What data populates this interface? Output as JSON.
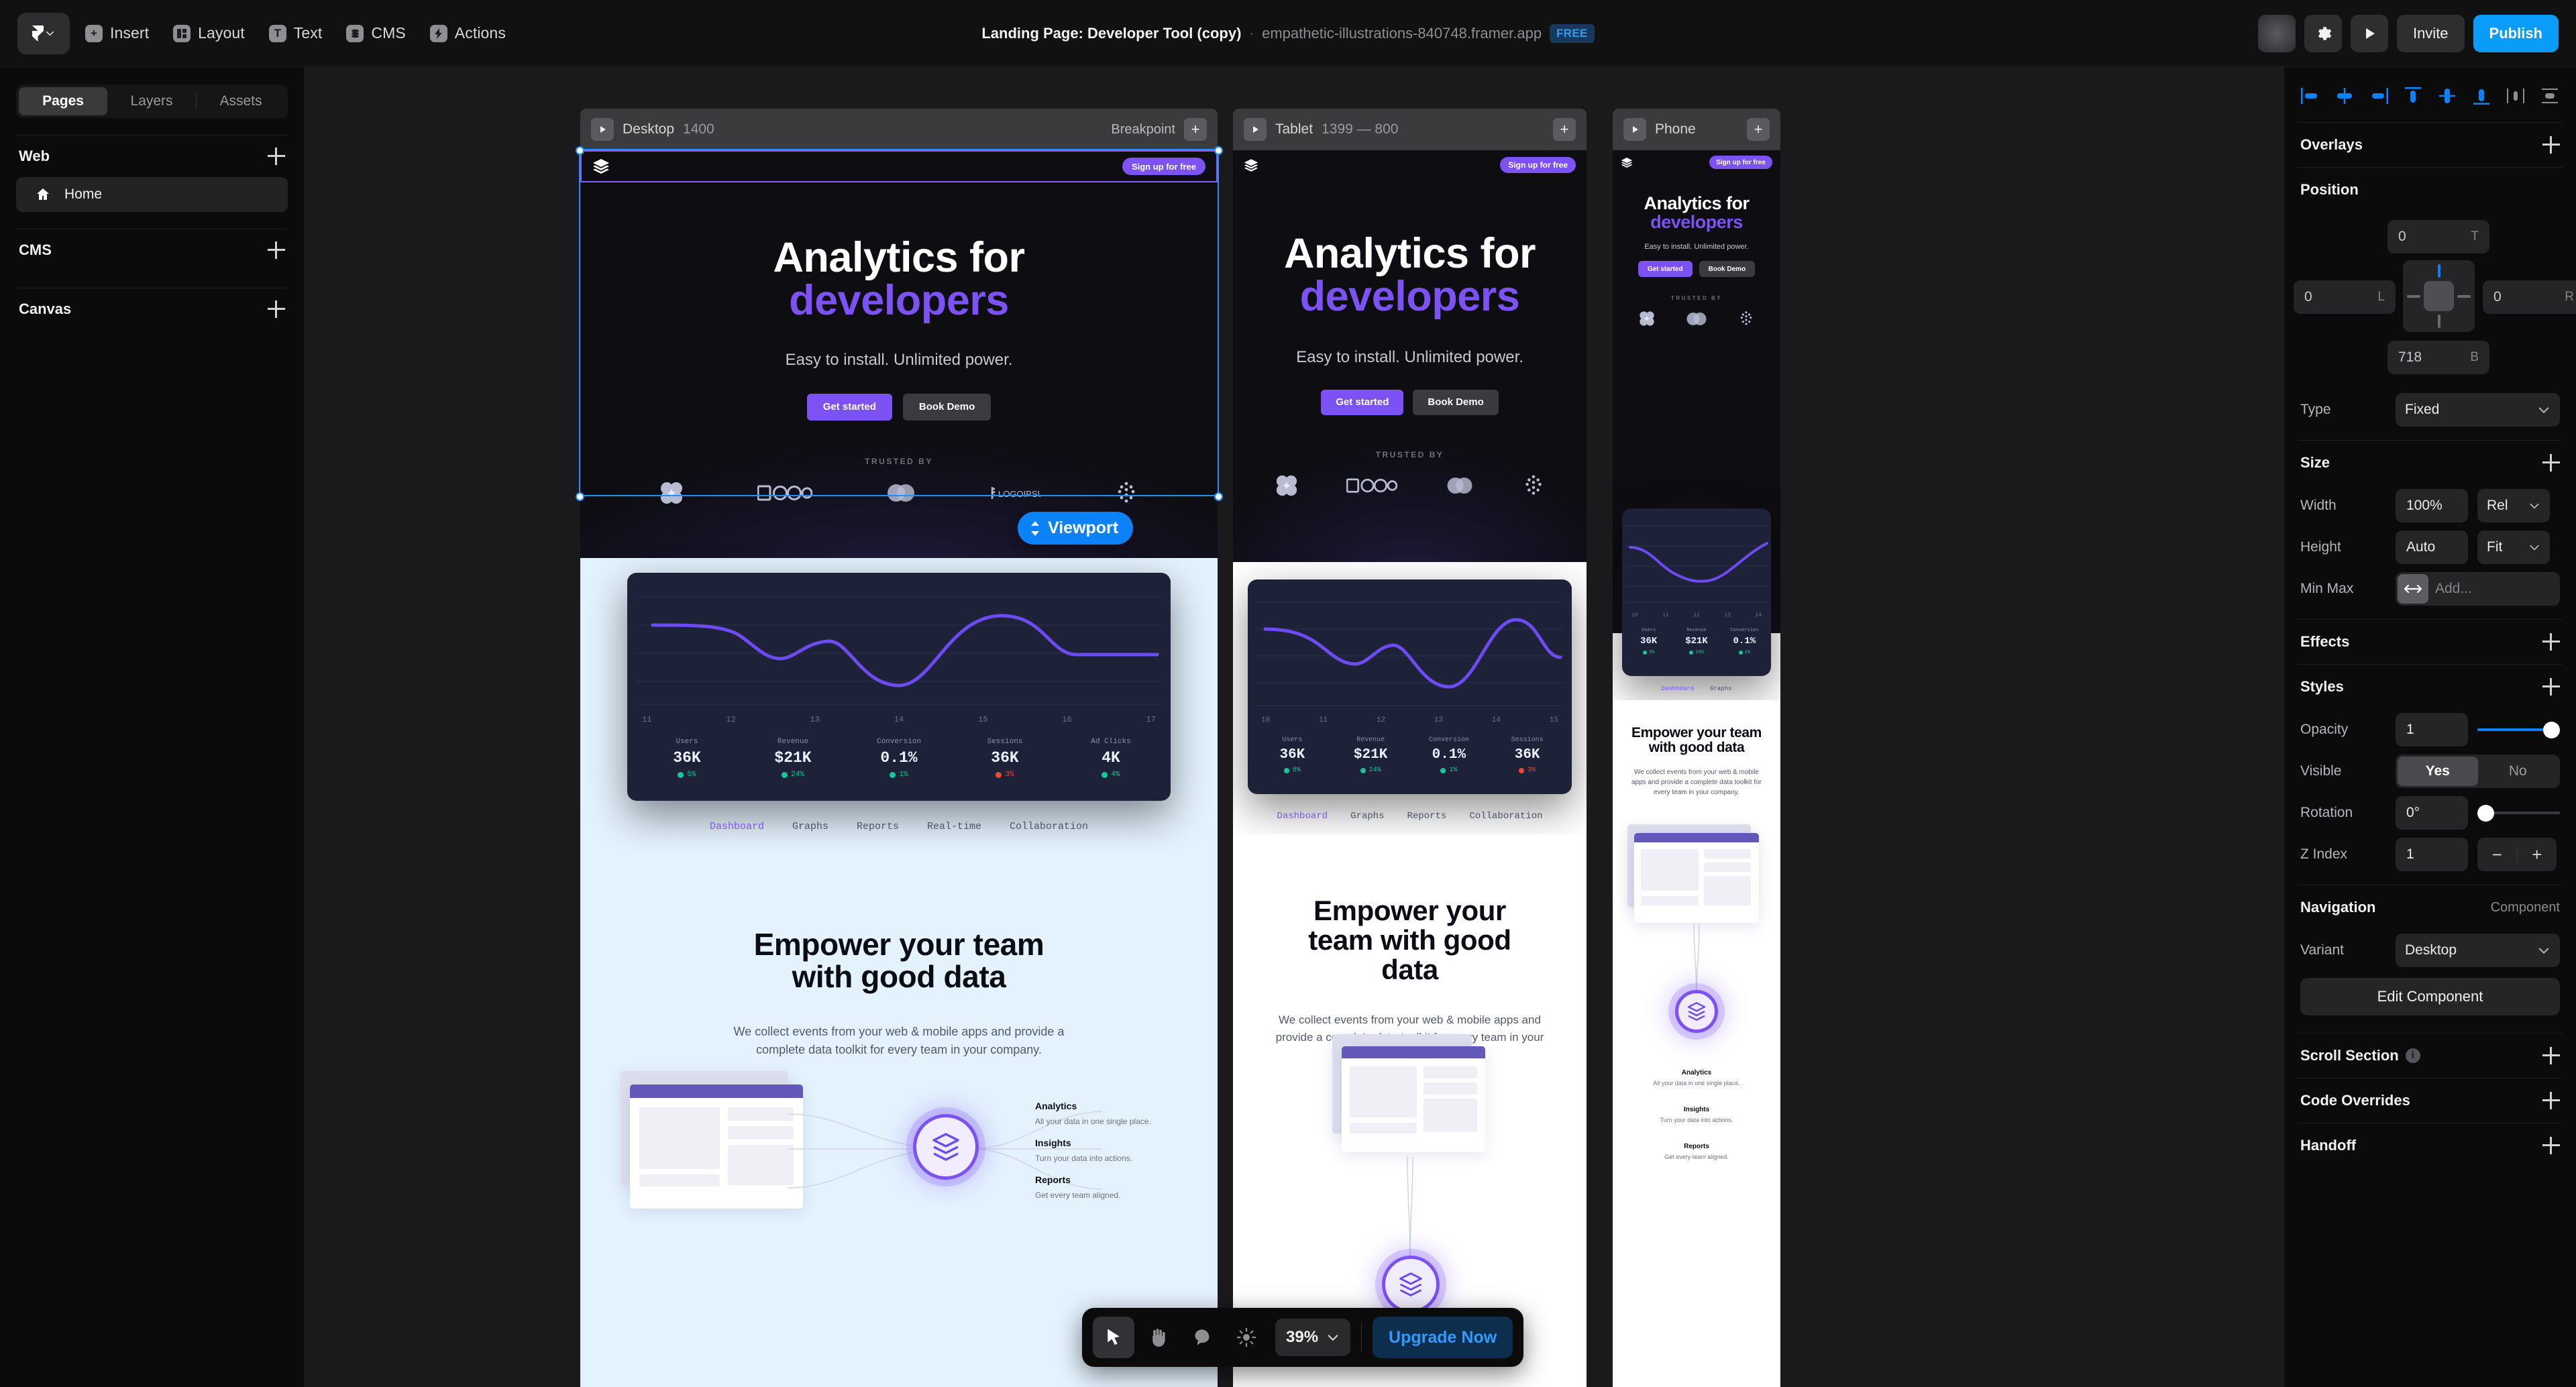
{
  "topbar": {
    "menu": [
      {
        "label": "Insert",
        "icon": "plus-icon"
      },
      {
        "label": "Layout",
        "icon": "layout-icon"
      },
      {
        "label": "Text",
        "icon": "text-icon"
      },
      {
        "label": "CMS",
        "icon": "cms-icon"
      },
      {
        "label": "Actions",
        "icon": "actions-icon"
      }
    ],
    "doc_title": "Landing Page: Developer Tool (copy)",
    "separator": "·",
    "doc_url": "empathetic-illustrations-840748.framer.app",
    "plan_badge": "FREE",
    "invite_label": "Invite",
    "publish_label": "Publish",
    "accent_publish": "#0b9bf8"
  },
  "sidebar": {
    "tabs": [
      {
        "label": "Pages",
        "active": true
      },
      {
        "label": "Layers",
        "active": false
      },
      {
        "label": "Assets",
        "active": false
      }
    ],
    "sections": [
      {
        "label": "Web"
      },
      {
        "label": "CMS"
      },
      {
        "label": "Canvas"
      }
    ],
    "pages": [
      {
        "label": "Home",
        "icon": "home-icon",
        "selected": true
      }
    ]
  },
  "canvas": {
    "frames": [
      {
        "name": "Desktop",
        "size": "1400",
        "breakpoint_label": "Breakpoint"
      },
      {
        "name": "Tablet",
        "size": "1399 — 800",
        "breakpoint_label": ""
      },
      {
        "name": "Phone",
        "size": "",
        "breakpoint_label": ""
      }
    ],
    "viewport_badge": "Viewport"
  },
  "site": {
    "nav": {
      "logo": "layers-logo-icon",
      "cta": "Sign up for free"
    },
    "hero": {
      "title_line1": "Analytics for",
      "title_line2": "developers",
      "subtitle": "Easy to install. Unlimited power.",
      "primary_cta": "Get started",
      "secondary_cta": "Book Demo",
      "trusted_by": "TRUSTED BY",
      "logos": [
        "clover-logo",
        "logo-box",
        "circles-logo",
        "logoipsum",
        "dots-logo"
      ]
    },
    "dashboard": {
      "stats": [
        {
          "label": "Users",
          "value": "36K",
          "delta": "5%",
          "direction": "up"
        },
        {
          "label": "Revenue",
          "value": "$21K",
          "delta": "24%",
          "direction": "up"
        },
        {
          "label": "Conversion",
          "value": "0.1%",
          "delta": "1%",
          "direction": "up"
        },
        {
          "label": "Sessions",
          "value": "36K",
          "delta": "3%",
          "direction": "down"
        },
        {
          "label": "Ad Clicks",
          "value": "4K",
          "delta": "4%",
          "direction": "up"
        }
      ],
      "tabs_desktop": [
        "Dashboard",
        "Graphs",
        "Reports",
        "Real-time",
        "Collaboration"
      ],
      "tabs_tablet": [
        "Dashboard",
        "Graphs",
        "Reports",
        "Collaboration"
      ],
      "tabs_phone": [
        "Dashboard",
        "Graphs"
      ],
      "active_tab": "Dashboard"
    },
    "features": {
      "heading_desktop": "Empower your team with good data",
      "heading_phone": "Empower your team with good data",
      "body": "We collect events from your web & mobile apps and provide a complete data toolkit for every team in your company.",
      "items": [
        {
          "title": "Analytics",
          "desc": "All your data in one single place."
        },
        {
          "title": "Insights",
          "desc": "Turn your data into actions."
        },
        {
          "title": "Reports",
          "desc": "Get every team aligned."
        }
      ]
    }
  },
  "chart_data": {
    "type": "line",
    "title": "",
    "xlabel": "",
    "ylabel": "",
    "grid": true,
    "legend": false,
    "series": [
      {
        "name": "Sessions",
        "color": "#6c4bf0",
        "x": [
          11,
          11.8,
          12.6,
          13.2,
          14.0,
          15.3,
          16.0,
          17.0
        ],
        "values": [
          62,
          62,
          44,
          52,
          26,
          76,
          44,
          44
        ]
      }
    ],
    "x_ticks_desktop": [
      "11",
      "12",
      "13",
      "14",
      "15",
      "16",
      "17"
    ],
    "x_ticks_tablet": [
      "10",
      "11",
      "12",
      "13",
      "14",
      "15"
    ],
    "x_ticks_phone": [
      "10",
      "11",
      "12",
      "13",
      "14"
    ],
    "xlim": [
      11,
      17
    ],
    "ylim": [
      0,
      100
    ]
  },
  "bottombar": {
    "tools": [
      {
        "name": "cursor-tool",
        "active": true
      },
      {
        "name": "hand-tool",
        "active": false
      },
      {
        "name": "comment-tool",
        "active": false
      },
      {
        "name": "theme-tool",
        "active": false
      }
    ],
    "zoom": "39%",
    "upgrade_label": "Upgrade Now"
  },
  "rpanel": {
    "align_icons": [
      "align-left-icon",
      "align-center-h-icon",
      "align-right-icon",
      "align-top-icon",
      "align-center-v-icon",
      "align-bottom-icon",
      "distribute-h-icon",
      "distribute-v-icon"
    ],
    "overlays": {
      "title": "Overlays"
    },
    "position": {
      "title": "Position",
      "top": "0",
      "top_unit": "T",
      "left": "0",
      "left_unit": "L",
      "right": "0",
      "right_unit": "R",
      "bottom": "718",
      "bottom_unit": "B",
      "type_label": "Type",
      "type_value": "Fixed"
    },
    "size": {
      "title": "Size",
      "width_label": "Width",
      "width_value": "100%",
      "width_mode": "Rel",
      "height_label": "Height",
      "height_value": "Auto",
      "height_mode": "Fit",
      "minmax_label": "Min Max",
      "minmax_placeholder": "Add..."
    },
    "effects": {
      "title": "Effects"
    },
    "styles": {
      "title": "Styles",
      "opacity_label": "Opacity",
      "opacity_value": "1",
      "visible_label": "Visible",
      "visible_yes": "Yes",
      "visible_no": "No",
      "visible_state": "Yes",
      "rotation_label": "Rotation",
      "rotation_value": "0°",
      "zindex_label": "Z Index",
      "zindex_value": "1"
    },
    "navigation": {
      "title": "Navigation",
      "note": "Component",
      "variant_label": "Variant",
      "variant_value": "Desktop",
      "edit_label": "Edit Component"
    },
    "scroll_section": {
      "title": "Scroll Section"
    },
    "code_overrides": {
      "title": "Code Overrides"
    },
    "handoff": {
      "title": "Handoff"
    }
  }
}
